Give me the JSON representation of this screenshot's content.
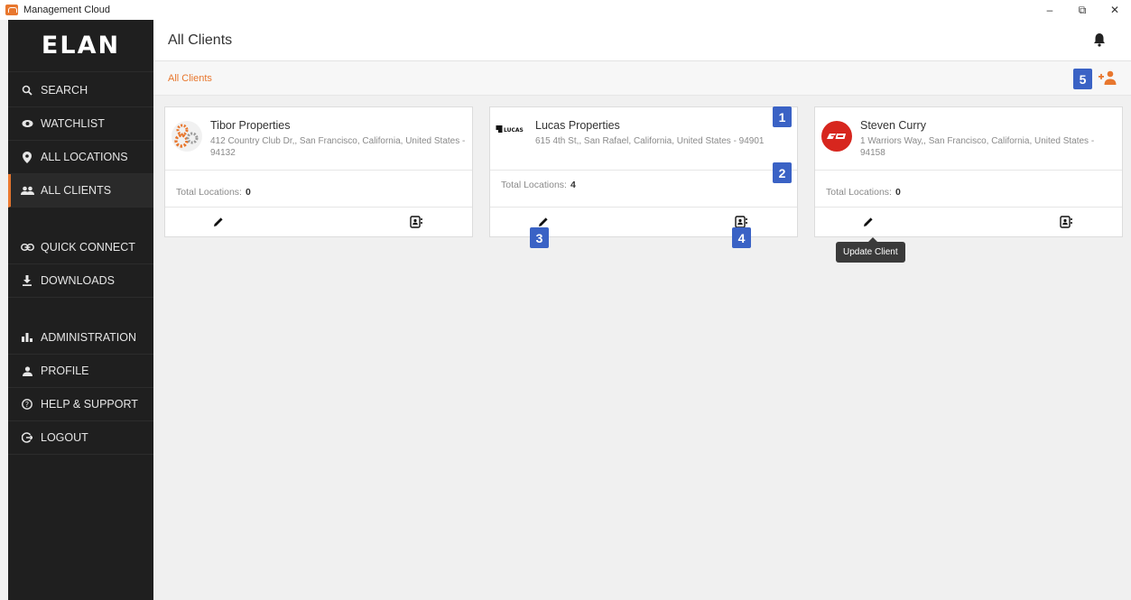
{
  "window": {
    "title": "Management Cloud",
    "controls": {
      "minimize": "–",
      "restore": "⧉",
      "close": "✕"
    }
  },
  "sidebar": {
    "logo": "ELAN",
    "items": [
      {
        "label": "SEARCH",
        "icon": "search-icon"
      },
      {
        "label": "WATCHLIST",
        "icon": "eye-icon"
      },
      {
        "label": "ALL LOCATIONS",
        "icon": "location-pin-icon"
      },
      {
        "label": "ALL CLIENTS",
        "icon": "people-icon",
        "active": true
      },
      {
        "label": "QUICK CONNECT",
        "icon": "link-icon"
      },
      {
        "label": "DOWNLOADS",
        "icon": "download-icon"
      },
      {
        "label": "ADMINISTRATION",
        "icon": "bar-chart-icon"
      },
      {
        "label": "PROFILE",
        "icon": "person-icon"
      },
      {
        "label": "HELP & SUPPORT",
        "icon": "help-icon"
      },
      {
        "label": "LOGOUT",
        "icon": "logout-icon"
      }
    ]
  },
  "header": {
    "title": "All Clients",
    "bell_icon": "bell-icon"
  },
  "breadcrumb": {
    "current": "All Clients"
  },
  "badges": [
    "1",
    "2",
    "3",
    "4",
    "5"
  ],
  "clients": [
    {
      "name": "Tibor Properties",
      "address": "412 Country Club Dr,, San Francisco, California, United States - 94132",
      "locations_label": "Total Locations:",
      "locations": "0",
      "logo": "gears-logo"
    },
    {
      "name": "Lucas Properties",
      "address": "615 4th St,, San Rafael, California, United States - 94901",
      "locations_label": "Total Locations:",
      "locations": "4",
      "logo": "lucas-logo",
      "logo_text": "LUCAS"
    },
    {
      "name": "Steven Curry",
      "address": "1 Warriors Way,, San Francisco, California, United States - 94158",
      "locations_label": "Total Locations:",
      "locations": "0",
      "logo": "sc-logo"
    }
  ],
  "tooltip": "Update Client",
  "colors": {
    "accent": "#e8772e",
    "sidebar_bg": "#1f1f1f",
    "badge": "#3a62c5"
  }
}
